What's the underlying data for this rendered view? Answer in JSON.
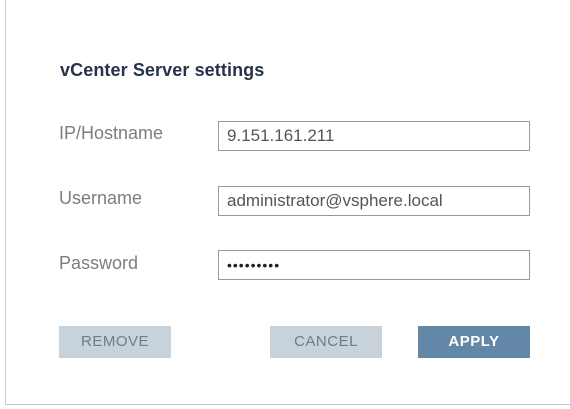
{
  "dialog": {
    "title": "vCenter Server settings"
  },
  "form": {
    "ip_label": "IP/Hostname",
    "ip_value": "9.151.161.211",
    "username_label": "Username",
    "username_value": "administrator@vsphere.local",
    "password_label": "Password",
    "password_value": "•••••••••"
  },
  "buttons": {
    "remove": "REMOVE",
    "cancel": "CANCEL",
    "apply": "APPLY"
  },
  "colors": {
    "title": "#26334a",
    "secondary_button_bg": "#c8d2db",
    "primary_button_bg": "#6387a7"
  }
}
